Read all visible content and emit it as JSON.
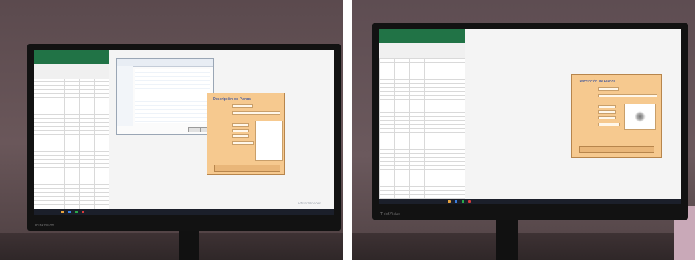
{
  "photos": [
    {
      "id": "left",
      "monitor_brand": "ThinkVision",
      "excel": {
        "ribbon_color": "#217346"
      },
      "access_form": {
        "title": "Descripción de Planos",
        "color": "#f6c98f"
      },
      "explorer_dialog": {
        "present": true
      },
      "watermark": "Activar Windows"
    },
    {
      "id": "right",
      "monitor_brand": "ThinkVision",
      "excel": {
        "ribbon_color": "#217346"
      },
      "access_form": {
        "title": "Descripción de Planos",
        "color": "#f6c98f"
      },
      "explorer_dialog": {
        "present": false
      },
      "watermark": ""
    }
  ]
}
